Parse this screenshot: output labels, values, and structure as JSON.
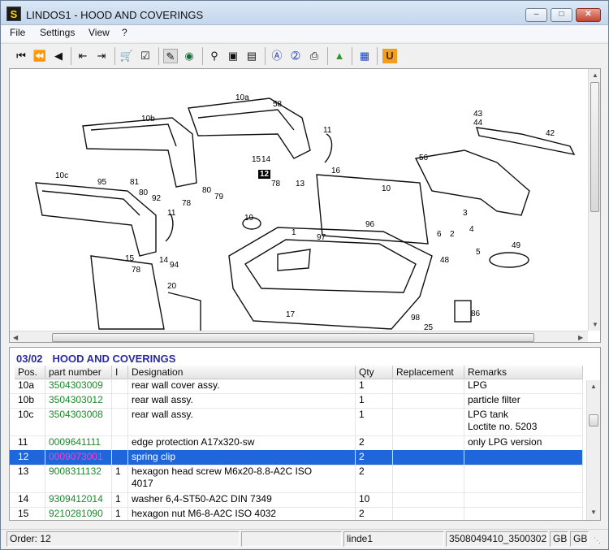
{
  "window": {
    "title": "LINDOS1 - HOOD AND COVERINGS",
    "icon_glyph": "S"
  },
  "menu": [
    "File",
    "Settings",
    "View",
    "?"
  ],
  "toolbar": {
    "icons": [
      "first-page-icon",
      "previous-fast-icon",
      "previous-icon",
      "jump-back-icon",
      "jump-forward-icon",
      "cart-icon",
      "checklist-icon",
      "pencil-tool-icon",
      "globe-icon",
      "zoom-icon",
      "page-view-icon",
      "page-fit-icon",
      "find-a-icon",
      "help-2-icon",
      "print-icon",
      "export-green-icon",
      "grid-blue-icon",
      "u-badge-icon"
    ],
    "u_badge": "U"
  },
  "drawing": {
    "callouts": [
      "10a",
      "58",
      "10b",
      "11",
      "15",
      "14",
      "12",
      "78",
      "13",
      "16",
      "56",
      "43",
      "44",
      "42",
      "10c",
      "95",
      "81",
      "80",
      "92",
      "78",
      "80",
      "79",
      "10",
      "11",
      "19",
      "96",
      "1",
      "97",
      "3",
      "4",
      "6",
      "2",
      "5",
      "49",
      "48",
      "15",
      "14",
      "78",
      "94",
      "20",
      "17",
      "98",
      "86",
      "25"
    ],
    "highlighted_callout": "12"
  },
  "parts": {
    "group_code": "03/02",
    "group_title": "HOOD AND COVERINGS",
    "columns": [
      "Pos.",
      "part number",
      "I",
      "Designation",
      "Qty",
      "Replacement",
      "Remarks"
    ],
    "rows": [
      {
        "pos": "10a",
        "part": "3504303009",
        "i": "",
        "designation": "rear wall cover assy.",
        "qty": "1",
        "replacement": "",
        "remarks": "LPG",
        "lines": 1
      },
      {
        "pos": "10b",
        "part": "3504303012",
        "i": "",
        "designation": "rear wall assy.",
        "qty": "1",
        "replacement": "",
        "remarks": "particle filter",
        "lines": 1
      },
      {
        "pos": "10c",
        "part": "3504303008",
        "i": "",
        "designation": "rear wall assy.",
        "qty": "1",
        "replacement": "",
        "remarks": "LPG tank\nLoctite no. 5203",
        "lines": 2
      },
      {
        "pos": "11",
        "part": "0009641111",
        "i": "",
        "designation": "edge protection A17x320-sw",
        "qty": "2",
        "replacement": "",
        "remarks": "only LPG version",
        "lines": 1
      },
      {
        "pos": "12",
        "part": "0009073001",
        "i": "",
        "designation": "spring clip",
        "qty": "2",
        "replacement": "",
        "remarks": "",
        "lines": 1,
        "selected": true
      },
      {
        "pos": "13",
        "part": "9008311132",
        "i": "1",
        "designation": "hexagon head screw M6x20-8.8-A2C  ISO\n4017",
        "qty": "2",
        "replacement": "",
        "remarks": "",
        "lines": 2
      },
      {
        "pos": "14",
        "part": "9309412014",
        "i": "1",
        "designation": "washer 6,4-ST50-A2C  DIN 7349",
        "qty": "10",
        "replacement": "",
        "remarks": "",
        "lines": 1
      },
      {
        "pos": "15",
        "part": "9210281090",
        "i": "1",
        "designation": "hexagon nut M6-8-A2C  ISO 4032",
        "qty": "2",
        "replacement": "",
        "remarks": "",
        "lines": 1
      }
    ]
  },
  "status": {
    "order": "Order: 12",
    "empty": "",
    "user": "linde1",
    "ref": "3508049410_3500302",
    "lang1": "GB",
    "lang2": "GB"
  }
}
